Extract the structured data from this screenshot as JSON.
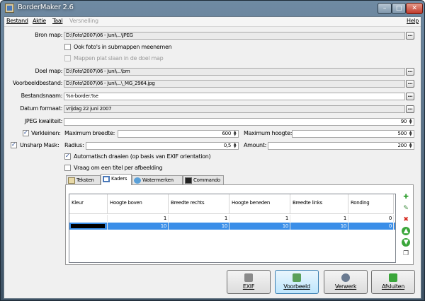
{
  "window": {
    "title": "BorderMaker 2.6",
    "min": "–",
    "max": "□",
    "close": "✕"
  },
  "menu": [
    "Bestand",
    "Aktie",
    "Taal",
    "Versnelling"
  ],
  "help": "Help",
  "form": {
    "bron_label": "Bron map:",
    "bron_value": "D:\\Foto\\2007\\06 - Juni\\...\\JPEG",
    "sub_label": "Ook foto's in submappen meenemen",
    "plat_label": "Mappen plat slaan in de doel map",
    "doel_label": "Doel map:",
    "doel_value": "D:\\Foto\\2007\\06 - Juni\\...\\bm",
    "voor_label": "Voorbeeldbestand:",
    "voor_value": "D:\\Foto\\2007\\06 - Juni\\...\\_MG_2964.jpg",
    "naam_label": "Bestandsnaam:",
    "naam_value": "%n-border.%e",
    "datum_label": "Datum formaat:",
    "datum_value": "vrijdag 22 juni 2007",
    "jpeg_label": "JPEG kwaliteit:",
    "jpeg_value": "90",
    "verk_label": "Verkleinen:",
    "maxb_label": "Maximum breedte:",
    "maxb_value": "600",
    "maxh_label": "Maximum hoogte:",
    "maxh_value": "500",
    "unsharp_label": "Unsharp Mask:",
    "radius_label": "Radius:",
    "radius_value": "0,5",
    "amount_label": "Amount:",
    "amount_value": "200",
    "auto_label": "Automatisch draaien (op basis van EXIF orientation)",
    "vraag_label": "Vraag om een titel per afbeelding",
    "dots": "..."
  },
  "tabs": [
    "Teksten",
    "Kaders",
    "Watermerken",
    "Commando"
  ],
  "table": {
    "headers": [
      "Kleur",
      "Hoogte boven",
      "Breedte rechts",
      "Hoogte beneden",
      "Breedte links",
      "Ronding"
    ],
    "rows": [
      [
        "",
        "1",
        "1",
        "1",
        "1",
        "0"
      ],
      [
        "",
        "10",
        "10",
        "10",
        "10",
        "0"
      ]
    ]
  },
  "side_icons": [
    "add-icon",
    "edit-icon",
    "delete-icon",
    "up-icon",
    "down-icon",
    "copy-icon"
  ],
  "buttons": {
    "exif": "EXIF",
    "voorbeeld": "Voorbeeld",
    "verwerk": "Verwerk",
    "afsluiten": "Afsluiten"
  }
}
